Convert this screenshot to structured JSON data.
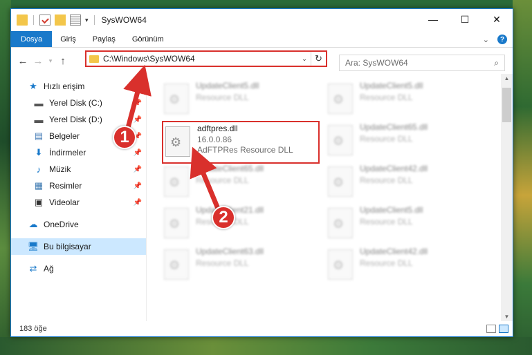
{
  "window": {
    "title": "SysWOW64",
    "controls": {
      "minimize": "—",
      "maximize": "☐",
      "close": "✕"
    }
  },
  "ribbon": {
    "tabs": [
      "Dosya",
      "Giriş",
      "Paylaş",
      "Görünüm"
    ]
  },
  "address": {
    "path": "C:\\Windows\\SysWOW64",
    "search_placeholder": "Ara: SysWOW64"
  },
  "sidebar": {
    "quick_access": "Hızlı erişim",
    "items": [
      {
        "label": "Yerel Disk (C:)",
        "icon": "drive-icon",
        "pinned": true
      },
      {
        "label": "Yerel Disk (D:)",
        "icon": "drive-icon",
        "pinned": true
      },
      {
        "label": "Belgeler",
        "icon": "documents-icon",
        "pinned": true
      },
      {
        "label": "İndirmeler",
        "icon": "downloads-icon",
        "pinned": true
      },
      {
        "label": "Müzik",
        "icon": "music-icon",
        "pinned": true
      },
      {
        "label": "Resimler",
        "icon": "pictures-icon",
        "pinned": true
      },
      {
        "label": "Videolar",
        "icon": "videos-icon",
        "pinned": true
      }
    ],
    "onedrive": "OneDrive",
    "this_pc": "Bu bilgisayar",
    "network": "Ağ"
  },
  "files": {
    "highlighted": {
      "name": "adftpres.dll",
      "version": "16.0.0.86",
      "description": "AdFTPRes Resource DLL"
    },
    "blurred": [
      {
        "name": "UpdateClient5.dll",
        "description": "Resource DLL"
      },
      {
        "name": "UpdateClient5.dll",
        "description": "Resource DLL"
      },
      {
        "name": "UpdateClient65.dll",
        "description": "Resource DLL"
      },
      {
        "name": "UpdateClient65.dll",
        "description": "Resource DLL"
      },
      {
        "name": "UpdateClient42.dll",
        "description": "Resource DLL"
      },
      {
        "name": "UpdateClient21.dll",
        "description": "Resource DLL"
      },
      {
        "name": "UpdateClient5.dll",
        "description": "Resource DLL"
      },
      {
        "name": "UpdateClient63.dll",
        "description": "Resource DLL"
      },
      {
        "name": "UpdateClient42.dll",
        "description": "Resource DLL"
      }
    ]
  },
  "status": {
    "count": "183 öğe"
  },
  "callouts": {
    "one": "1",
    "two": "2"
  },
  "colors": {
    "accent": "#1979ca",
    "highlight": "#d9302c",
    "selected": "#cce8ff"
  }
}
